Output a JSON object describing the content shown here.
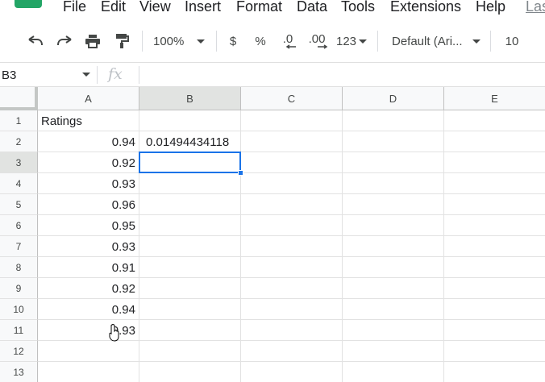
{
  "menu": {
    "items": [
      "File",
      "Edit",
      "View",
      "Insert",
      "Format",
      "Data",
      "Tools",
      "Extensions",
      "Help"
    ],
    "last_edit": "Las"
  },
  "toolbar": {
    "zoom": "100%",
    "currency": "$",
    "percent": "%",
    "decrease_decimal": ".0",
    "increase_decimal": ".00",
    "more_formats": "123",
    "font": "Default (Ari...",
    "font_size": "10",
    "icons": [
      "undo-icon",
      "redo-icon",
      "print-icon",
      "paint-format-icon"
    ]
  },
  "formula_bar": {
    "name_box": "B3",
    "fx_label": "fx",
    "content": ""
  },
  "sheet": {
    "columns": [
      "A",
      "B",
      "C",
      "D",
      "E"
    ],
    "rows": [
      "1",
      "2",
      "3",
      "4",
      "5",
      "6",
      "7",
      "8",
      "9",
      "10",
      "11",
      "12",
      "13"
    ],
    "cells": {
      "A1": "Ratings",
      "A2": "0.94",
      "A3": "0.92",
      "A4": "0.93",
      "A5": "0.96",
      "A6": "0.95",
      "A7": "0.93",
      "A8": "0.91",
      "A9": "0.92",
      "A10": "0.94",
      "A11": "0.93",
      "B2": "0.01494434118"
    },
    "selected_cell": "B3"
  },
  "colors": {
    "selection": "#1a73e8",
    "header_bg": "#f8f9fa",
    "active_header_bg": "#e1e3e1",
    "logo": "#23a566"
  }
}
